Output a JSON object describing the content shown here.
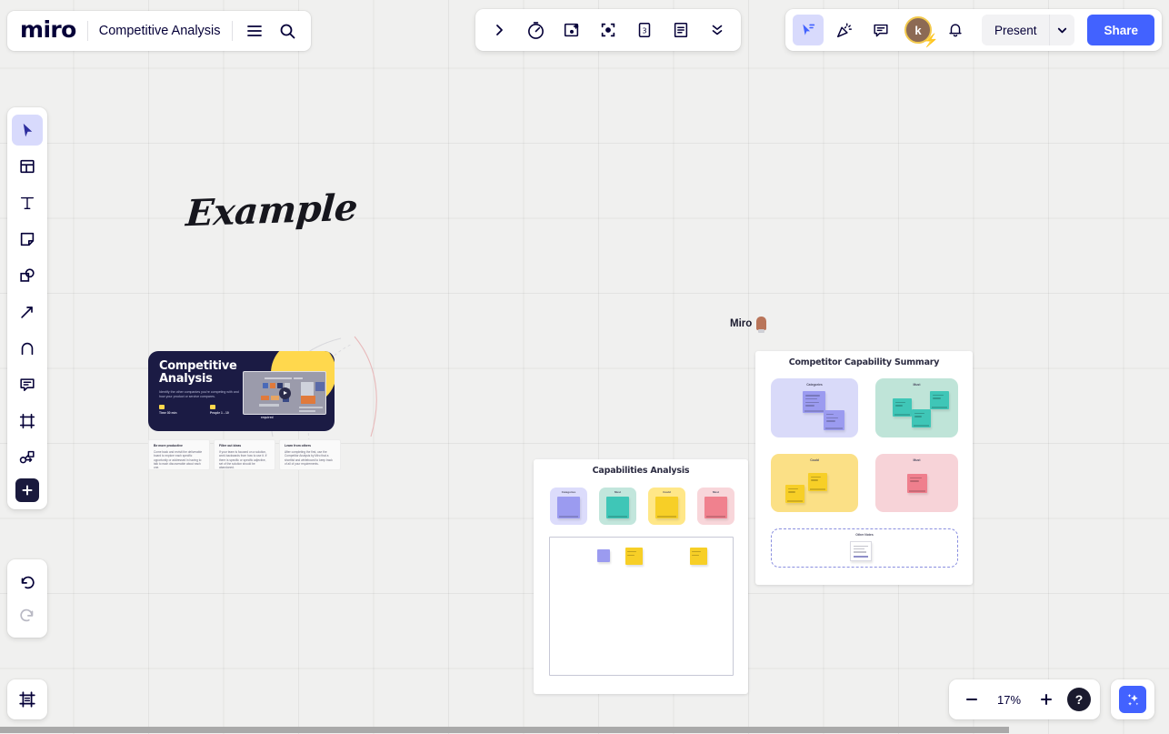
{
  "app": {
    "logo_text": "miro",
    "board_title": "Competitive Analysis"
  },
  "topbar_left": {
    "menu_icon": "hamburger-menu-icon",
    "search_icon": "search-icon"
  },
  "topbar_center": {
    "items": [
      {
        "name": "expand-toolbar-chevron-icon",
        "label": ""
      },
      {
        "name": "timer-icon",
        "label": ""
      },
      {
        "name": "screenshot-icon",
        "label": ""
      },
      {
        "name": "focus-mode-icon",
        "label": ""
      },
      {
        "name": "voting-icon",
        "label": ""
      },
      {
        "name": "notes-icon",
        "label": ""
      },
      {
        "name": "more-tools-chevron-icon",
        "label": ""
      }
    ]
  },
  "topbar_right": {
    "cursor_tool_label": "",
    "celebrate_label": "",
    "comments_label": "",
    "avatar_initial": "k",
    "notifications_label": "",
    "present_label": "Present",
    "present_caret_label": "",
    "share_label": "Share",
    "accent_color": "#4262ff"
  },
  "left_rail": {
    "tools": [
      {
        "name": "select-tool",
        "icon": "cursor-icon",
        "active": true
      },
      {
        "name": "templates-tool",
        "icon": "template-icon",
        "active": false
      },
      {
        "name": "text-tool",
        "icon": "text-icon",
        "active": false
      },
      {
        "name": "sticky-note-tool",
        "icon": "sticky-note-icon",
        "active": false
      },
      {
        "name": "shapes-tool",
        "icon": "shapes-icon",
        "active": false
      },
      {
        "name": "connection-line-tool",
        "icon": "arrow-icon",
        "active": false
      },
      {
        "name": "pen-tool",
        "icon": "pen-icon",
        "active": false
      },
      {
        "name": "comment-tool",
        "icon": "comment-icon",
        "active": false
      },
      {
        "name": "frame-tool",
        "icon": "frame-icon",
        "active": false
      },
      {
        "name": "diagram-tool",
        "icon": "diagram-icon",
        "active": false
      },
      {
        "name": "more-apps-tool",
        "icon": "plus-icon",
        "active": false
      }
    ],
    "history": [
      {
        "name": "undo-button",
        "icon": "undo-icon",
        "disabled": false
      },
      {
        "name": "redo-button",
        "icon": "redo-icon",
        "disabled": true
      }
    ]
  },
  "bottom_left": {
    "frames_panel_icon": "frames-panel-icon"
  },
  "zoom_controls": {
    "zoom_out_label": "−",
    "zoom_level": "17%",
    "zoom_in_label": "+",
    "help_label": "?",
    "ai_icon": "sparkles-icon"
  },
  "canvas": {
    "background_color": "#f0f0ef",
    "grid_color": "#e3e3e2",
    "example_label": "Example"
  },
  "collaborator": {
    "name": "Miro",
    "cursor_color": "#b9755a"
  },
  "competitive_analysis_card": {
    "title": "Competitive Analysis",
    "subtitle": "Identify the other companies you're competing with and how your product or service compares.",
    "meta": [
      {
        "chip_color": "#ffd84d",
        "label": "Time 30 min"
      },
      {
        "chip_color": "#ffd84d",
        "label": "People 1 - 10"
      },
      {
        "chip_color": "#e8e8f2",
        "label": "Facilitation experience none required"
      }
    ]
  },
  "info_cards": [
    {
      "heading": "Be more productive",
      "body": "Come back and revisit the deliverable board to explore each specific opportunity or addressed in having to talk to each discoverable about each one."
    },
    {
      "heading": "Filter out ideas",
      "body": "If your team is focused on a solution, work backwards from how to use it. If there is specific or specific adjective, set of the solution should be abandoned."
    },
    {
      "heading": "Learn from others",
      "body": "After completing the first, use the Competitor Analysis by Miro that a shortlist and whiteboard to keep track of all of your requirements.",
      "link_text": "Competitor Analysis"
    }
  ],
  "frames": [
    {
      "name": "capabilities-analysis-frame",
      "title": "Capabilities Analysis",
      "tiles": [
        {
          "label": "Categories",
          "tile_color": "#dcdcfb",
          "note_color": "#9b9bf0"
        },
        {
          "label": "Must",
          "tile_color": "#c2e6dc",
          "note_color": "#3fc6b7"
        },
        {
          "label": "Could",
          "tile_color": "#ffe788",
          "note_color": "#f7cf27"
        },
        {
          "label": "Must",
          "tile_color": "#f8d6da",
          "note_color": "#f0818e"
        }
      ],
      "inner_notes": [
        {
          "color": "#9b9bf0",
          "has_text": false
        },
        {
          "color": "#f7cf27",
          "has_text": true
        },
        {
          "color": "#f7cf27",
          "has_text": true
        }
      ]
    },
    {
      "name": "competitor-capability-summary-frame",
      "title": "Competitor Capability Summary",
      "zones": [
        {
          "label": "Categories",
          "zone_color": "#d9daf9",
          "notes": [
            {
              "color": "#9b9bf0"
            },
            {
              "color": "#9b9bf0"
            }
          ]
        },
        {
          "label": "Must",
          "zone_color": "#bfe4d8",
          "notes": [
            {
              "color": "#3fc6b7"
            },
            {
              "color": "#3fc6b7"
            },
            {
              "color": "#3fc6b7"
            }
          ]
        },
        {
          "label": "Could",
          "zone_color": "#fbe086",
          "notes": [
            {
              "color": "#f7cf27"
            },
            {
              "color": "#f7cf27"
            }
          ]
        },
        {
          "label": "Must",
          "zone_color": "#f7d3d8",
          "notes": [
            {
              "color": "#ef7f8d"
            }
          ]
        }
      ],
      "footer": {
        "label": "Other Notes",
        "note_text": "Competitive Analysis workflow capability summary"
      }
    }
  ]
}
